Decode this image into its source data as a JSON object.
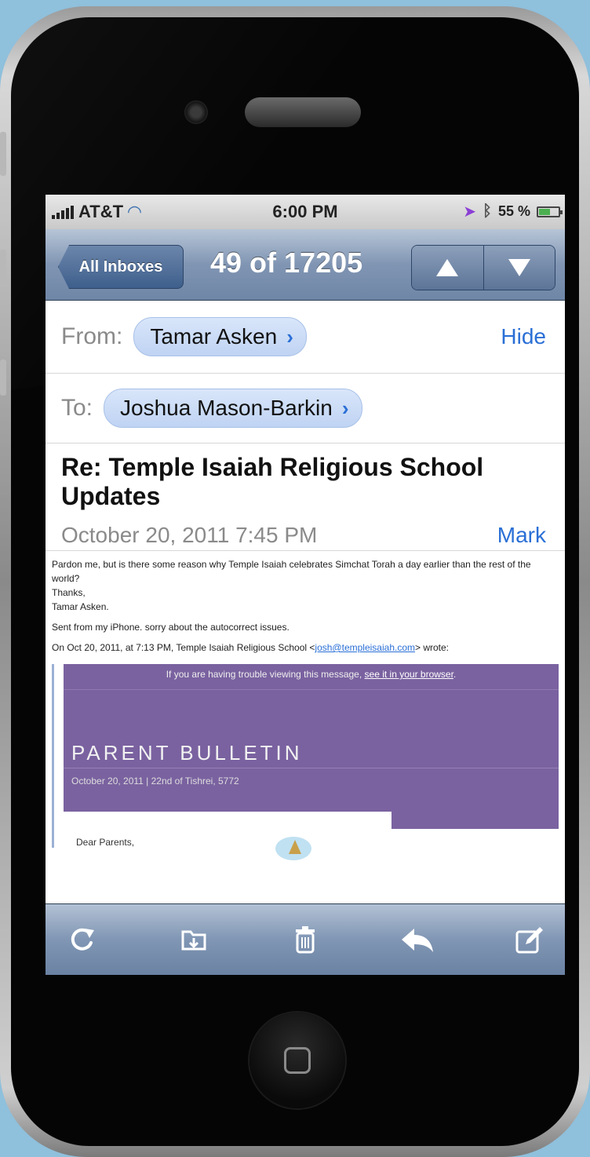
{
  "status": {
    "carrier": "AT&T",
    "time": "6:00 PM",
    "battery": "55 %"
  },
  "nav": {
    "back_label": "All Inboxes",
    "title": "49 of 17205"
  },
  "header": {
    "from_label": "From:",
    "from_name": "Tamar Asken",
    "hide_label": "Hide",
    "to_label": "To:",
    "to_name": "Joshua Mason-Barkin",
    "subject": "Re: Temple Isaiah Religious School Updates",
    "date": "October 20, 2011 7:45 PM",
    "mark_label": "Mark"
  },
  "body": {
    "line1": "Pardon me, but is there some reason why Temple Isaiah celebrates Simchat Torah a day earlier than the rest of the world?",
    "line2": "Thanks,",
    "line3": "Tamar Asken.",
    "line4": "Sent from my iPhone. sorry about the autocorrect issues.",
    "quote_intro": "On Oct 20, 2011, at 7:13 PM, Temple Isaiah Religious School <",
    "quote_email": "josh@templeisaiah.com",
    "quote_outro": "> wrote:"
  },
  "bulletin": {
    "trouble_text": "If you are having trouble viewing this message,",
    "trouble_link": "see it in your browser",
    "title": "PARENT BULLETIN",
    "dateline": "October 20, 2011 | 22nd of Tishrei, 5772",
    "greeting": "Dear Parents,"
  },
  "toolbar": {
    "icons": [
      "refresh-icon",
      "move-folder-icon",
      "trash-icon",
      "reply-icon",
      "compose-icon"
    ]
  },
  "colors": {
    "accent": "#2a6fd6",
    "navbar": "#6f86a6",
    "bulletin": "#7a62a0"
  }
}
